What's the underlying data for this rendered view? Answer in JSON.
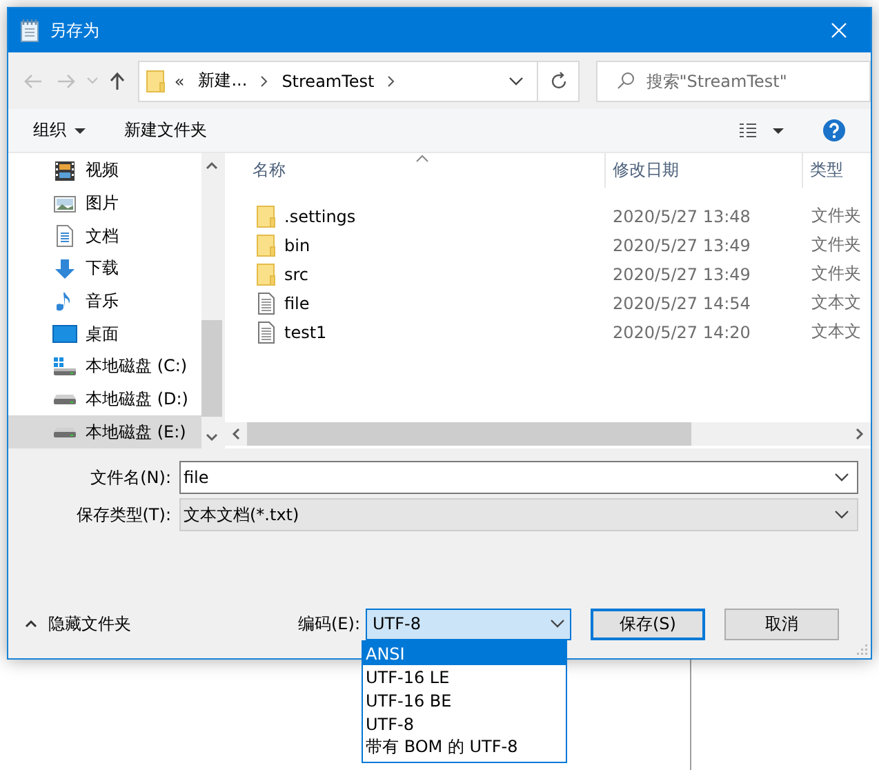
{
  "window": {
    "title": "另存为"
  },
  "address_bar": {
    "overflow": "«",
    "segments": [
      "新建...",
      "StreamTest"
    ]
  },
  "search": {
    "placeholder": "搜索\"StreamTest\""
  },
  "command_bar": {
    "organize": "组织",
    "new_folder": "新建文件夹"
  },
  "sidebar": {
    "items": [
      {
        "label": "视频",
        "kind": "video",
        "selected": false
      },
      {
        "label": "图片",
        "kind": "pictures",
        "selected": false
      },
      {
        "label": "文档",
        "kind": "documents",
        "selected": false
      },
      {
        "label": "下载",
        "kind": "downloads",
        "selected": false
      },
      {
        "label": "音乐",
        "kind": "music",
        "selected": false
      },
      {
        "label": "桌面",
        "kind": "desktop",
        "selected": false
      },
      {
        "label": "本地磁盘 (C:)",
        "kind": "system-drive",
        "selected": false
      },
      {
        "label": "本地磁盘 (D:)",
        "kind": "drive",
        "selected": false
      },
      {
        "label": "本地磁盘 (E:)",
        "kind": "drive",
        "selected": true
      }
    ]
  },
  "file_list": {
    "columns": [
      "名称",
      "修改日期",
      "类型"
    ],
    "rows": [
      {
        "name": ".settings",
        "modified": "2020/5/27 13:48",
        "type": "文件夹",
        "kind": "folder"
      },
      {
        "name": "bin",
        "modified": "2020/5/27 13:49",
        "type": "文件夹",
        "kind": "folder"
      },
      {
        "name": "src",
        "modified": "2020/5/27 13:49",
        "type": "文件夹",
        "kind": "folder"
      },
      {
        "name": "file",
        "modified": "2020/5/27 14:54",
        "type": "文本文",
        "kind": "file"
      },
      {
        "name": "test1",
        "modified": "2020/5/27 14:20",
        "type": "文本文",
        "kind": "file"
      }
    ]
  },
  "form": {
    "file_name": {
      "label": "文件名(N):",
      "value": "file"
    },
    "file_type": {
      "label": "保存类型(T):",
      "value": "文本文档(*.txt)"
    }
  },
  "footer": {
    "hide_folders": "隐藏文件夹",
    "encoding": {
      "label": "编码(E):",
      "value": "UTF-8",
      "expanded": true,
      "options": [
        {
          "label": "ANSI",
          "highlighted": true
        },
        {
          "label": "UTF-16 LE",
          "highlighted": false
        },
        {
          "label": "UTF-16 BE",
          "highlighted": false
        },
        {
          "label": "UTF-8",
          "highlighted": false
        },
        {
          "label": "带有 BOM 的 UTF-8",
          "highlighted": false
        }
      ]
    },
    "buttons": [
      {
        "label": "保存(S)",
        "default": true
      },
      {
        "label": "取消",
        "default": false
      }
    ]
  }
}
